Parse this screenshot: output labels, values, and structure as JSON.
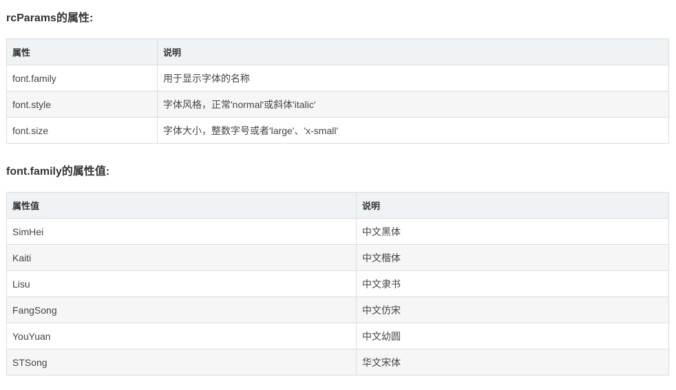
{
  "section1": {
    "heading": "rcParams的属性:",
    "table": {
      "headers": [
        "属性",
        "说明"
      ],
      "rows": [
        [
          "font.family",
          "用于显示字体的名称"
        ],
        [
          "font.style",
          "字体风格，正常'normal'或斜体'italic'"
        ],
        [
          "font.size",
          "字体大小，整数字号或者'large'、'x-small'"
        ]
      ]
    }
  },
  "section2": {
    "heading": "font.family的属性值:",
    "table": {
      "headers": [
        "属性值",
        "说明"
      ],
      "rows": [
        [
          "SimHei",
          "中文黑体"
        ],
        [
          "Kaiti",
          "中文楷体"
        ],
        [
          "Lisu",
          "中文隶书"
        ],
        [
          "FangSong",
          "中文仿宋"
        ],
        [
          "YouYuan",
          "中文幼圆"
        ],
        [
          "STSong",
          "华文宋体"
        ]
      ]
    }
  }
}
